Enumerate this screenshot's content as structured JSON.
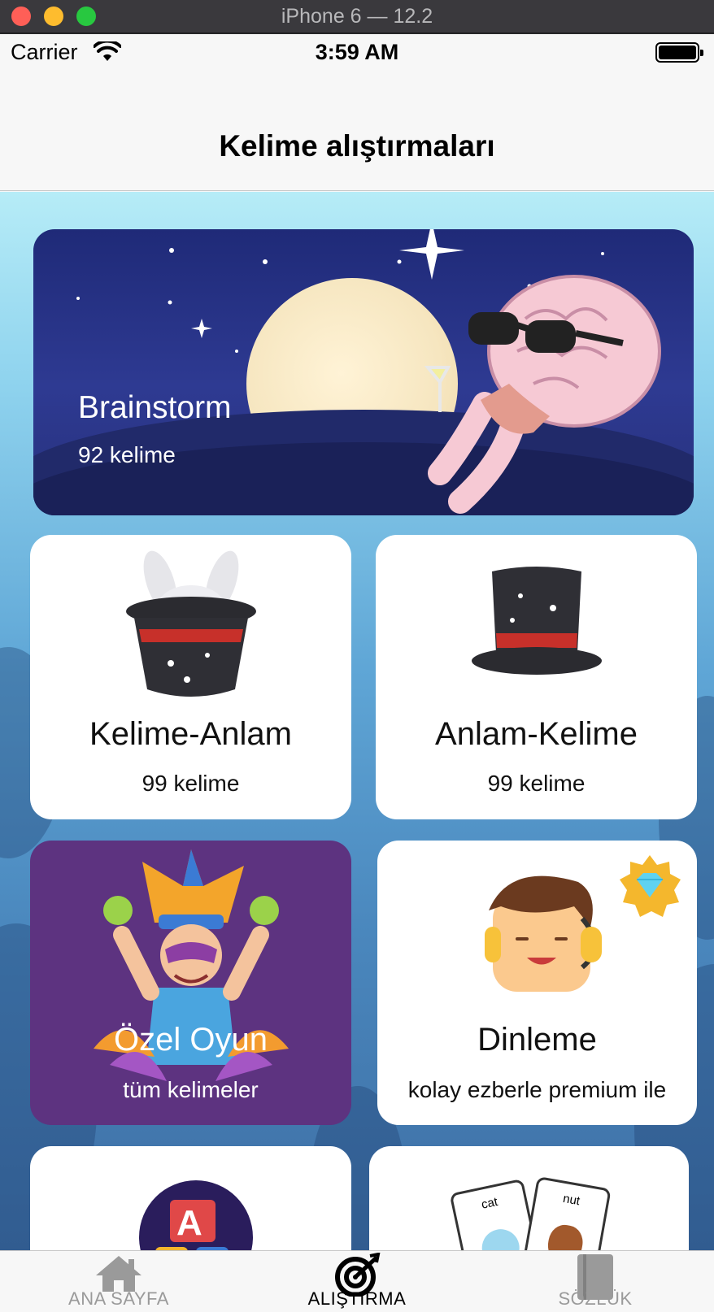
{
  "window": {
    "title": "iPhone 6 — 12.2"
  },
  "statusbar": {
    "carrier": "Carrier",
    "time": "3:59 AM"
  },
  "navbar": {
    "title": "Kelime alıştırmaları"
  },
  "cards": {
    "brainstorm": {
      "title": "Brainstorm",
      "subtitle": "92 kelime"
    },
    "kelime_anlam": {
      "title": "Kelime-Anlam",
      "subtitle": "99 kelime"
    },
    "anlam_kelime": {
      "title": "Anlam-Kelime",
      "subtitle": "99 kelime"
    },
    "ozel_oyun": {
      "title": "Özel Oyun",
      "subtitle": "tüm kelimeler"
    },
    "dinleme": {
      "title": "Dinleme",
      "subtitle": "kolay ezberle premium ile"
    },
    "flashcards": {
      "card_left": "cat",
      "card_right": "nut"
    }
  },
  "tabbar": {
    "items": [
      {
        "label": "ANA SAYFA",
        "icon": "home-icon",
        "active": false
      },
      {
        "label": "ALIŞTIRMA",
        "icon": "target-icon",
        "active": true
      },
      {
        "label": "SÖZLÜK",
        "icon": "book-icon",
        "active": false
      }
    ]
  },
  "colors": {
    "ozel_card_bg": "#5d3380",
    "brain_card_bg": "#2e3a92",
    "active_tab": "#000000",
    "inactive_tab": "#9a9a9a"
  }
}
